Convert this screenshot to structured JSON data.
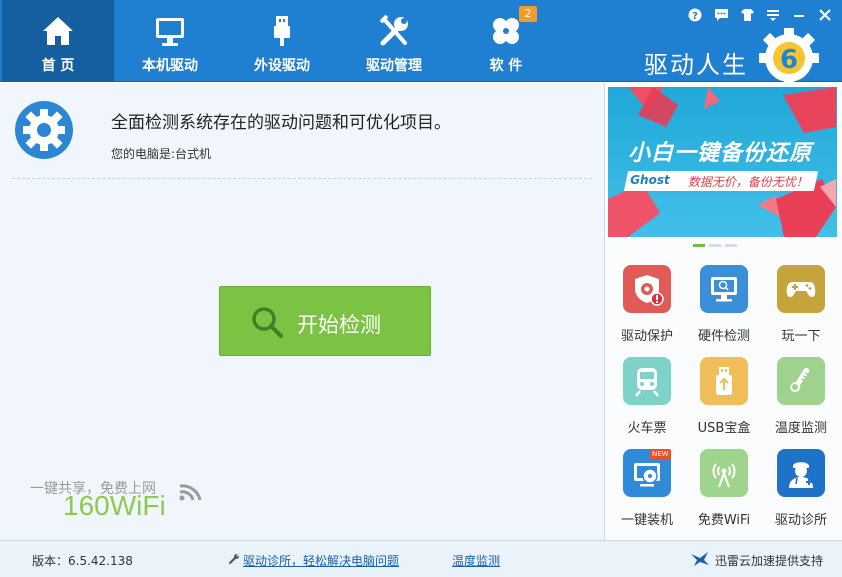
{
  "nav": {
    "tabs": [
      {
        "label": "首 页",
        "icon": "home-icon",
        "active": true
      },
      {
        "label": "本机驱动",
        "icon": "monitor-icon"
      },
      {
        "label": "外设驱动",
        "icon": "usb-icon"
      },
      {
        "label": "驱动管理",
        "icon": "tools-icon"
      },
      {
        "label": "软 件",
        "icon": "clover-icon",
        "badge": "2"
      }
    ]
  },
  "window_controls": [
    "help-icon",
    "feedback-icon",
    "skin-icon",
    "menu-icon",
    "minimize-icon",
    "close-icon"
  ],
  "brand": {
    "title": "驱动人生",
    "logo_digit": "6"
  },
  "main": {
    "headline": "全面检测系统存在的驱动问题和可优化项目。",
    "subline": "您的电脑是:台式机",
    "start_button": "开始检测",
    "wifi_promo": {
      "line1": "一键共享，免费上网",
      "line2": "160WiFi"
    }
  },
  "banner": {
    "title": "小白一键备份还原",
    "tag": "Ghost",
    "slogan": "数据无价，备份无忧！",
    "dots": 3,
    "active_dot": 0
  },
  "tools": [
    {
      "label": "驱动保护",
      "icon": "shield-gear-icon",
      "color": "#e05b55"
    },
    {
      "label": "硬件检测",
      "icon": "monitor-check-icon",
      "color": "#3a8fd6"
    },
    {
      "label": "玩一下",
      "icon": "gamepad-icon",
      "color": "#c5a53b"
    },
    {
      "label": "火车票",
      "icon": "train-icon",
      "color": "#7fd2c8"
    },
    {
      "label": "USB宝盒",
      "icon": "usb-drive-icon",
      "color": "#f0bd5a"
    },
    {
      "label": "温度监测",
      "icon": "thermometer-icon",
      "color": "#9fd28f"
    },
    {
      "label": "一键装机",
      "icon": "install-disc-icon",
      "color": "#2f8ad8",
      "badge": "NEW"
    },
    {
      "label": "免费WiFi",
      "icon": "wifi-tower-icon",
      "color": "#9ed48c"
    },
    {
      "label": "驱动诊所",
      "icon": "doctor-icon",
      "color": "#1f72c7"
    }
  ],
  "status": {
    "version": "版本：6.5.42.138",
    "diag_link": "驱动诊所，轻松解决电脑问题",
    "temp_link": "温度监测",
    "xunlei": "迅雷云加速提供支持"
  }
}
